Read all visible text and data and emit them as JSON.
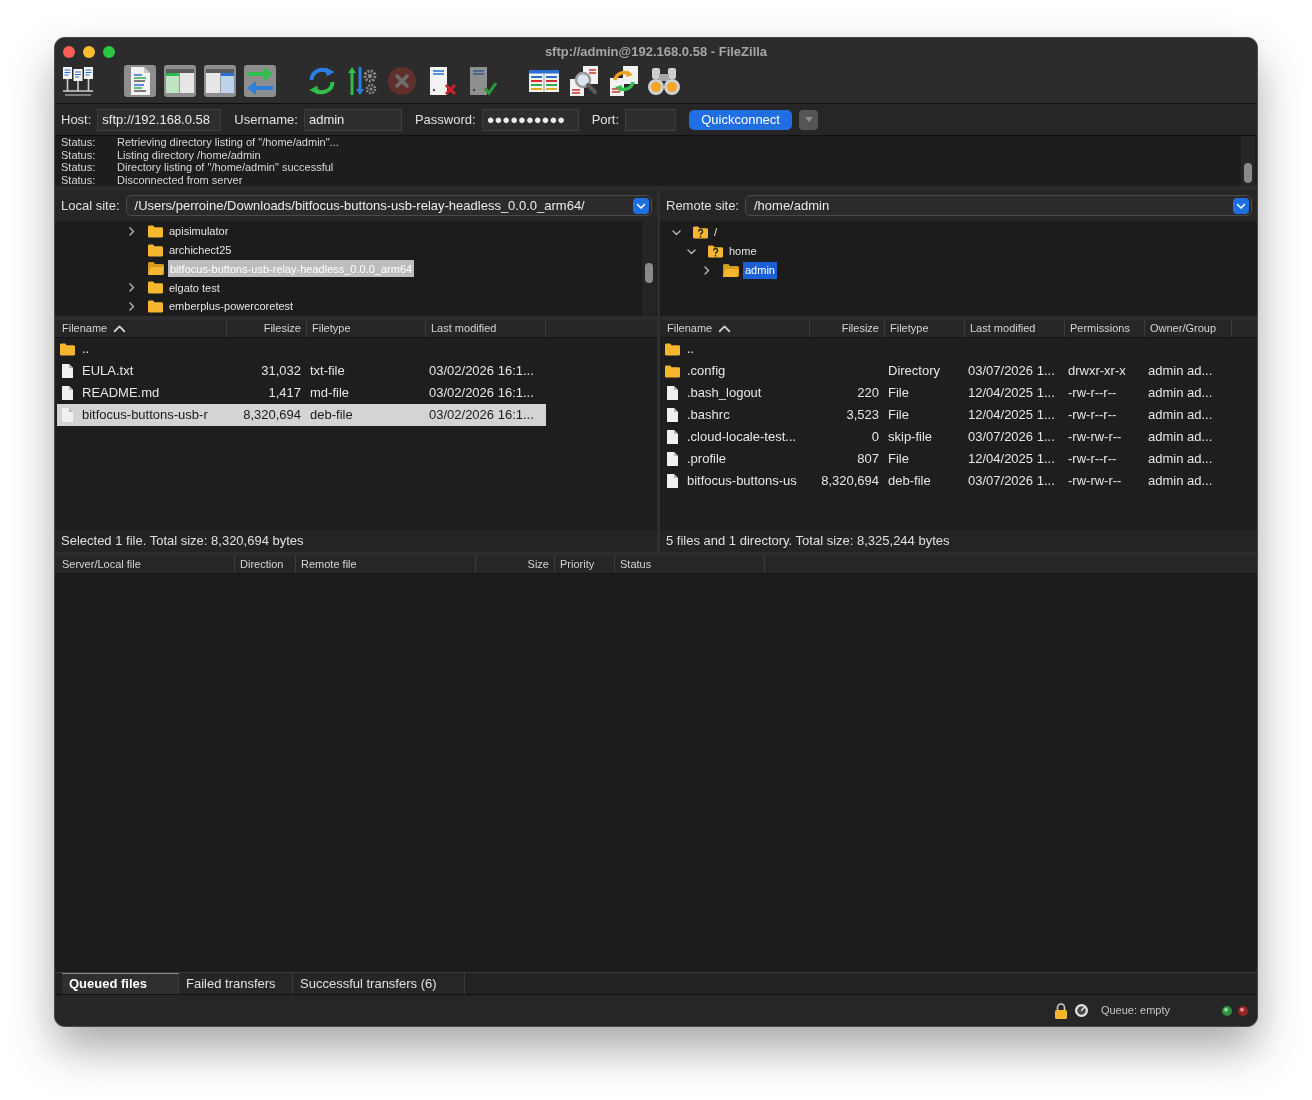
{
  "window": {
    "title": "sftp://admin@192.168.0.58 - FileZilla"
  },
  "toolbar": {
    "groups": [
      {
        "buttons": [
          {
            "kind": "site-manager",
            "disabled": false
          }
        ]
      },
      {
        "buttons": [
          {
            "kind": "message-log",
            "on": true,
            "disabled": false
          },
          {
            "kind": "local-tree",
            "on": true,
            "disabled": false
          },
          {
            "kind": "remote-tree",
            "on": true,
            "disabled": false
          },
          {
            "kind": "transfer-queue",
            "on": true,
            "disabled": false
          }
        ]
      },
      {
        "buttons": [
          {
            "kind": "refresh",
            "disabled": false
          },
          {
            "kind": "process-queue",
            "disabled": false
          },
          {
            "kind": "cancel",
            "disabled": true
          },
          {
            "kind": "disconnect",
            "disabled": false
          },
          {
            "kind": "reconnect",
            "disabled": false
          }
        ]
      },
      {
        "buttons": [
          {
            "kind": "filter",
            "disabled": false
          },
          {
            "kind": "compare",
            "disabled": false
          },
          {
            "kind": "sync",
            "disabled": false
          },
          {
            "kind": "find",
            "disabled": false
          }
        ]
      }
    ]
  },
  "quickconnect": {
    "fields": [
      {
        "label": "Host:",
        "value": "sftp://192.168.0.58"
      },
      {
        "label": "Username:",
        "value": "admin"
      },
      {
        "label": "Password:",
        "value": "●●●●●●●●●●"
      },
      {
        "label": "Port:"
      }
    ],
    "button": "Quickconnect"
  },
  "log": [
    {
      "label": "Status:",
      "message": "Retrieving directory listing of \"/home/admin\"..."
    },
    {
      "label": "Status:",
      "message": "Listing directory /home/admin"
    },
    {
      "label": "Status:",
      "message": "Directory listing of \"/home/admin\" successful"
    },
    {
      "label": "Status:",
      "message": "Disconnected from server"
    }
  ],
  "local": {
    "label": "Local site:",
    "path": "/Users/perroine/Downloads/bitfocus-buttons-usb-relay-headless_0.0.0_arm64/",
    "tree": [
      {
        "name": "apisimulator",
        "kind": "folder",
        "expanded": false,
        "selected": false
      },
      {
        "name": "archichect25",
        "kind": "folder",
        "selected": false
      },
      {
        "name": "bitfocus-buttons-usb-relay-headless_0.0.0_arm64",
        "kind": "folder",
        "selected": true
      },
      {
        "name": "elgato test",
        "kind": "folder",
        "expanded": false,
        "selected": false
      },
      {
        "name": "emberplus-powercoretest",
        "kind": "folder",
        "expanded": false,
        "selected": false
      }
    ],
    "columns": [
      {
        "label": "Filename",
        "sorted": true
      },
      {
        "label": "Filesize",
        "sorted": false
      },
      {
        "label": "Filetype",
        "sorted": false
      },
      {
        "label": "Last modified",
        "sorted": false
      }
    ],
    "rows": [
      {
        "kind": "folder",
        "filename": "..",
        "selected": false
      },
      {
        "kind": "file",
        "filename": "EULA.txt",
        "filesize": "31,032",
        "filetype": "txt-file",
        "last_modified": "03/02/2026 16:1...",
        "selected": false
      },
      {
        "kind": "file",
        "filename": "README.md",
        "filesize": "1,417",
        "filetype": "md-file",
        "last_modified": "03/02/2026 16:1...",
        "selected": false
      },
      {
        "kind": "file",
        "filename": "bitfocus-buttons-usb-r",
        "filesize": "8,320,694",
        "filetype": "deb-file",
        "last_modified": "03/02/2026 16:1...",
        "selected": true
      }
    ],
    "status": "Selected 1 file. Total size: 8,320,694 bytes"
  },
  "remote": {
    "label": "Remote site:",
    "path": "/home/admin",
    "tree": [
      {
        "name": "/",
        "kind": "unknown-folder",
        "expanded": true,
        "selected": false,
        "children": [
          {
            "name": "home",
            "kind": "unknown-folder",
            "expanded": true,
            "selected": false,
            "children": [
              {
                "name": "admin",
                "kind": "folder",
                "expanded": false,
                "selected": true
              }
            ]
          }
        ]
      }
    ],
    "columns": [
      {
        "label": "Filename",
        "sorted": true
      },
      {
        "label": "Filesize",
        "sorted": false
      },
      {
        "label": "Filetype",
        "sorted": false
      },
      {
        "label": "Last modified",
        "sorted": false
      },
      {
        "label": "Permissions",
        "sorted": false
      },
      {
        "label": "Owner/Group",
        "sorted": false
      }
    ],
    "rows": [
      {
        "kind": "folder",
        "filename": "..",
        "selected": false
      },
      {
        "kind": "folder",
        "filename": ".config",
        "filetype": "Directory",
        "last_modified": "03/07/2026 1...",
        "permissions": "drwxr-xr-x",
        "owner_group": "admin ad...",
        "selected": false
      },
      {
        "kind": "file",
        "filename": ".bash_logout",
        "filesize": "220",
        "filetype": "File",
        "last_modified": "12/04/2025 1...",
        "permissions": "-rw-r--r--",
        "owner_group": "admin ad...",
        "selected": false
      },
      {
        "kind": "file",
        "filename": ".bashrc",
        "filesize": "3,523",
        "filetype": "File",
        "last_modified": "12/04/2025 1...",
        "permissions": "-rw-r--r--",
        "owner_group": "admin ad...",
        "selected": false
      },
      {
        "kind": "file",
        "filename": ".cloud-locale-test...",
        "filesize": "0",
        "filetype": "skip-file",
        "last_modified": "03/07/2026 1...",
        "permissions": "-rw-rw-r--",
        "owner_group": "admin ad...",
        "selected": false
      },
      {
        "kind": "file",
        "filename": ".profile",
        "filesize": "807",
        "filetype": "File",
        "last_modified": "12/04/2025 1...",
        "permissions": "-rw-r--r--",
        "owner_group": "admin ad...",
        "selected": false
      },
      {
        "kind": "file",
        "filename": "bitfocus-buttons-us",
        "filesize": "8,320,694",
        "filetype": "deb-file",
        "last_modified": "03/07/2026 1...",
        "permissions": "-rw-rw-r--",
        "owner_group": "admin ad...",
        "selected": false
      }
    ],
    "status": "5 files and 1 directory. Total size: 8,325,244 bytes"
  },
  "queue": {
    "columns": [
      "Server/Local file",
      "Direction",
      "Remote file",
      "Size",
      "Priority",
      "Status"
    ],
    "tabs": [
      {
        "label": "Queued files",
        "selected": true
      },
      {
        "label": "Failed transfers",
        "selected": false
      },
      {
        "label": "Successful transfers (6)",
        "selected": false
      }
    ]
  },
  "status_bar": {
    "queue": "Queue: empty"
  }
}
